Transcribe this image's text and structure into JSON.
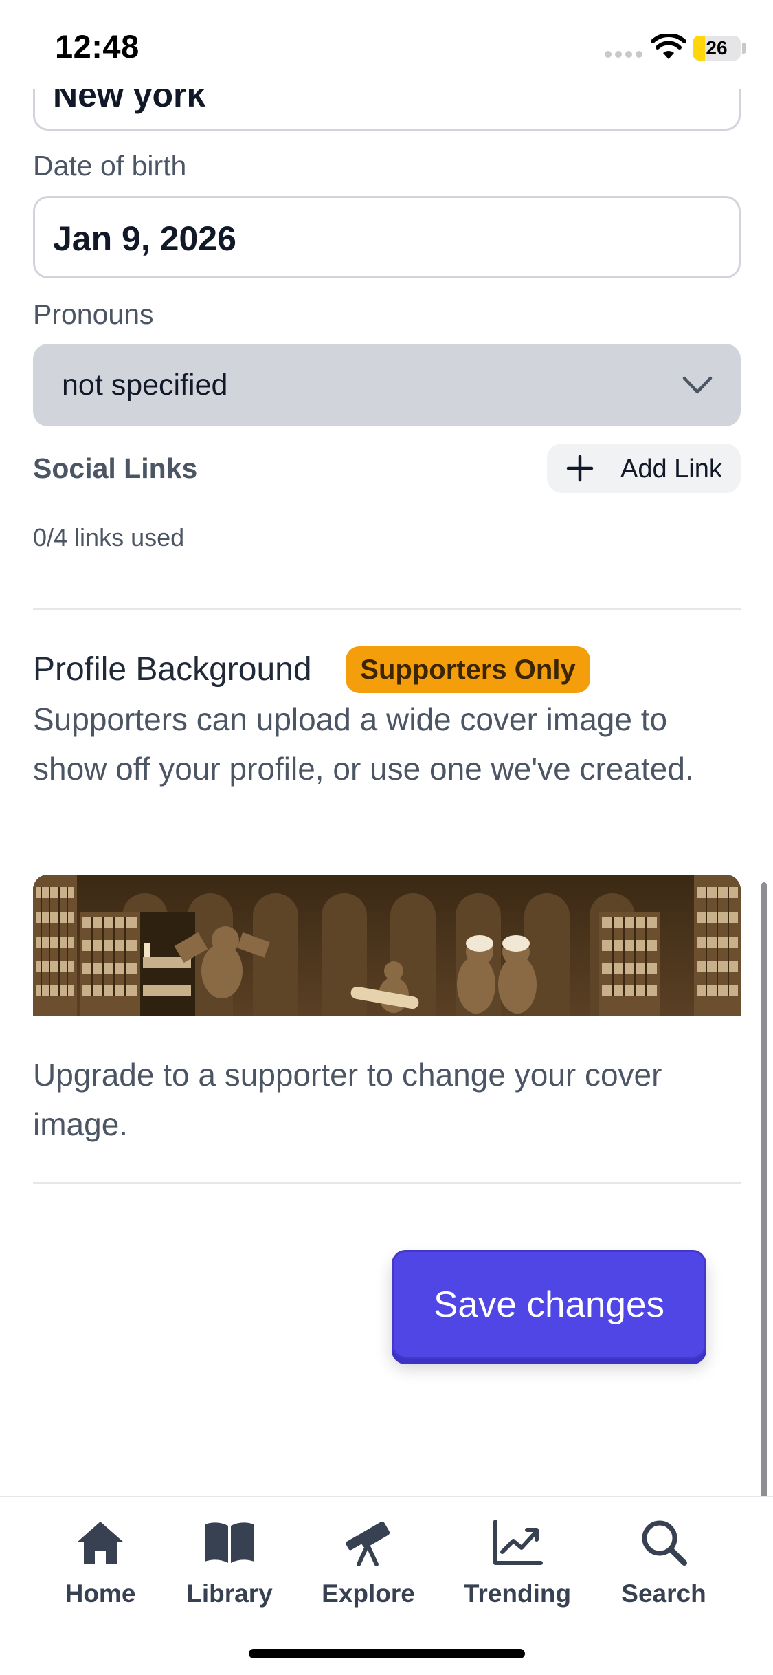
{
  "status_bar": {
    "time": "12:48",
    "battery": "26",
    "battery_level": 0.26
  },
  "form": {
    "city_value": "New york",
    "dob_label": "Date of birth",
    "dob_value": "Jan 9, 2026",
    "pronouns_label": "Pronouns",
    "pronouns_value": "not specified",
    "social_links_title": "Social Links",
    "add_link_label": "Add Link",
    "links_used": "0/4 links used"
  },
  "profile_background": {
    "title": "Profile Background",
    "badge": "Supporters Only",
    "description": "Supporters can upload a wide cover image to show off your profile, or use one we've created.",
    "upgrade_text": "Upgrade to a supporter to change your cover image."
  },
  "actions": {
    "save_label": "Save changes"
  },
  "tab_bar": {
    "items": [
      {
        "label": "Home",
        "icon": "home-icon"
      },
      {
        "label": "Library",
        "icon": "book-icon"
      },
      {
        "label": "Explore",
        "icon": "telescope-icon"
      },
      {
        "label": "Trending",
        "icon": "trending-chart-icon"
      },
      {
        "label": "Search",
        "icon": "search-icon"
      }
    ]
  },
  "colors": {
    "primary": "#4f46e5",
    "badge": "#f59e0b",
    "text_muted": "#4b5563",
    "select_bg": "#d1d5db"
  }
}
